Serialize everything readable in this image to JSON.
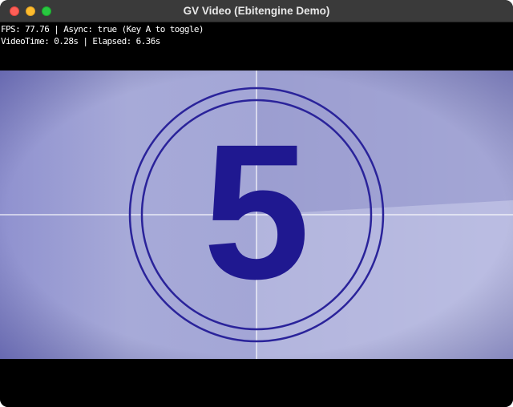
{
  "window": {
    "title": "GV Video (Ebitengine Demo)"
  },
  "overlay": {
    "line1": "FPS: 77.76 | Async: true (Key A to toggle)",
    "line2": "VideoTime: 0.28s | Elapsed: 6.36s"
  },
  "video": {
    "countdown_number": "5",
    "colors": {
      "frame_background": "#a9abd8",
      "ring": "#1f1890",
      "digit": "#1f1890",
      "crosshair": "#ffffff"
    }
  }
}
